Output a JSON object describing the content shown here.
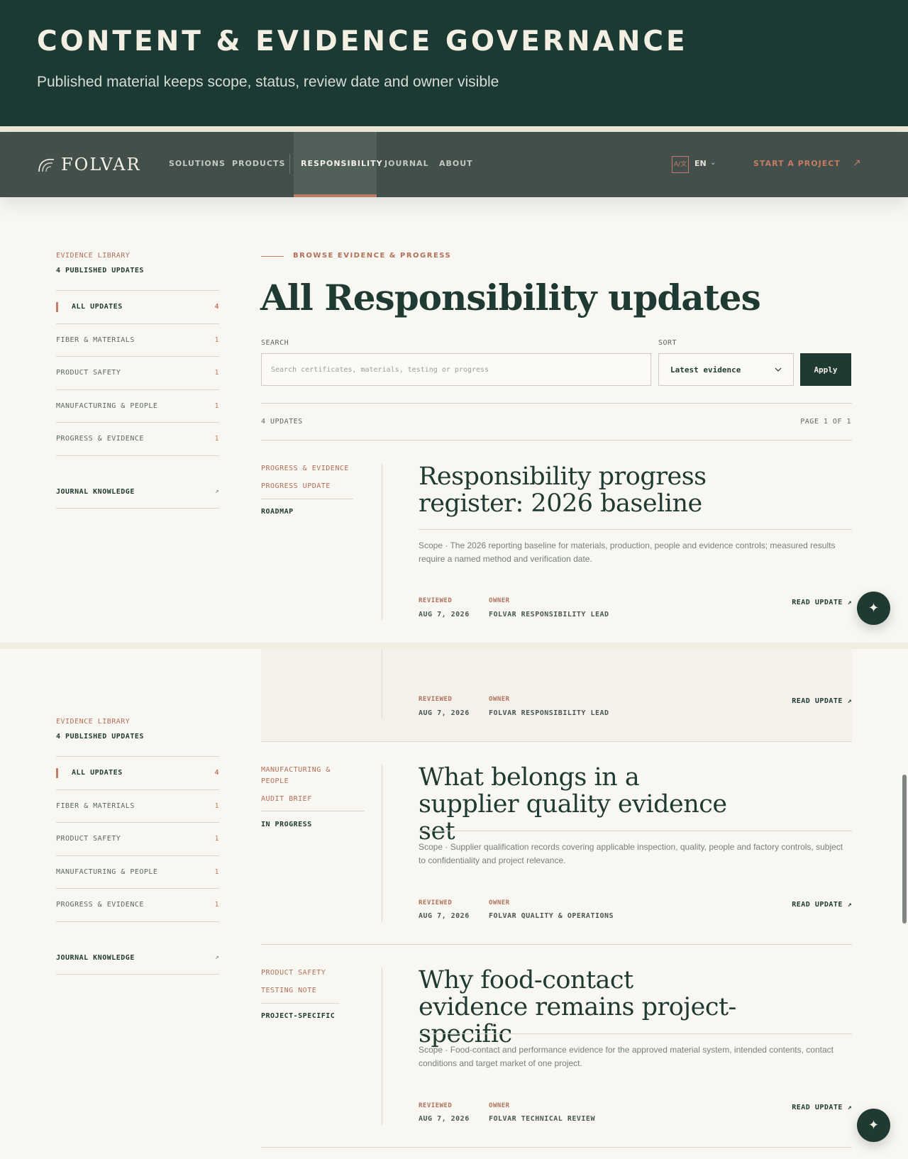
{
  "banner": {
    "title": "CONTENT & EVIDENCE GOVERNANCE",
    "subtitle": "Published material keeps scope, status, review date and owner visible"
  },
  "nav": {
    "logo": "FOLVAR",
    "items": [
      "SOLUTIONS",
      "PRODUCTS",
      "RESPONSIBILITY",
      "JOURNAL",
      "ABOUT"
    ],
    "active": "RESPONSIBILITY",
    "lang_icon": "A/文",
    "lang": "EN",
    "cta": "START A PROJECT",
    "cta_arrow": "↗"
  },
  "sidebar": {
    "eyebrow": "EVIDENCE LIBRARY",
    "count": "4 PUBLISHED UPDATES",
    "items": [
      {
        "label": "ALL UPDATES",
        "count": "4"
      },
      {
        "label": "FIBER & MATERIALS",
        "count": "1"
      },
      {
        "label": "PRODUCT SAFETY",
        "count": "1"
      },
      {
        "label": "MANUFACTURING & PEOPLE",
        "count": "1"
      },
      {
        "label": "PROGRESS & EVIDENCE",
        "count": "1"
      }
    ],
    "journal": "JOURNAL KNOWLEDGE",
    "journal_arrow": "↗"
  },
  "main": {
    "eyebrow": "BROWSE EVIDENCE & PROGRESS",
    "title": "All Responsibility updates",
    "search_label": "SEARCH",
    "search_placeholder": "Search certificates, materials, testing or progress",
    "sort_label": "SORT",
    "sort_value": "Latest evidence",
    "apply": "Apply",
    "results_count": "4 UPDATES",
    "results_page": "PAGE 1 OF 1"
  },
  "labels": {
    "reviewed": "REVIEWED",
    "owner": "OWNER",
    "read": "READ UPDATE ↗"
  },
  "cards": [
    {
      "category": "PROGRESS & EVIDENCE",
      "type": "PROGRESS UPDATE",
      "status": "ROADMAP",
      "title": "Responsibility progress register: 2026 baseline",
      "scope": "Scope · The 2026 reporting baseline for materials, production, people and evidence controls; measured results require a named method and verification date.",
      "reviewed": "AUG 7, 2026",
      "owner": "FOLVAR RESPONSIBILITY LEAD"
    },
    {
      "category": "MANUFACTURING & PEOPLE",
      "type": "AUDIT BRIEF",
      "status": "IN PROGRESS",
      "title": "What belongs in a supplier quality evidence set",
      "scope": "Scope · Supplier qualification records covering applicable inspection, quality, people and factory controls, subject to confidentiality and project relevance.",
      "reviewed": "AUG 7, 2026",
      "owner": "FOLVAR QUALITY & OPERATIONS"
    },
    {
      "category": "PRODUCT SAFETY",
      "type": "TESTING NOTE",
      "status": "PROJECT-SPECIFIC",
      "title": "Why food-contact evidence remains project-specific",
      "scope": "Scope · Food-contact and performance evidence for the approved material system, intended contents, contact conditions and target market of one project.",
      "reviewed": "AUG 7, 2026",
      "owner": "FOLVAR TECHNICAL REVIEW"
    }
  ],
  "fab_icon": "✦"
}
